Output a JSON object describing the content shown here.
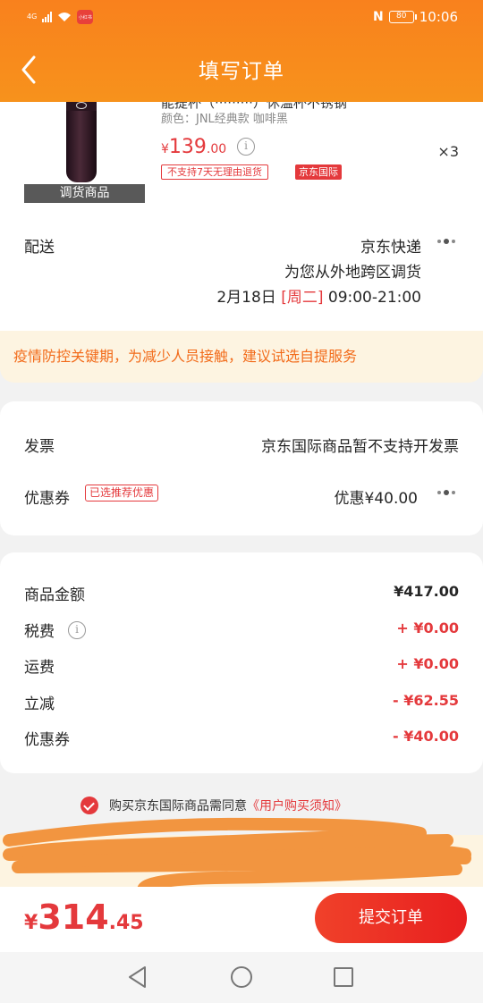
{
  "status_bar": {
    "network": "4G",
    "app_badge": "小红书",
    "nfc": "N",
    "battery": "80",
    "time": "10:06"
  },
  "header": {
    "title": "填写订单",
    "back_icon": "chevron-left-icon"
  },
  "product": {
    "name_partial": "能提杯（·········）休温杯不锈钢",
    "color_spec": "颜色：JNL经典款 咖啡黑",
    "price_currency": "¥",
    "price_int": "139",
    "price_dec": ".00",
    "quantity": "×3",
    "image_tag": "调货商品",
    "badge_no_return": "不支持7天无理由退货",
    "badge_intl": "京东国际"
  },
  "delivery": {
    "label": "配送",
    "carrier": "京东快递",
    "note": "为您从外地跨区调货",
    "date": "2月18日",
    "weekday": "[周二]",
    "time_window": "09:00-21:00"
  },
  "notice": "疫情防控关键期，为减少人员接触，建议试选自提服务",
  "invoice": {
    "label": "发票",
    "value": "京东国际商品暂不支持开发票"
  },
  "coupon": {
    "label": "优惠券",
    "tag": "已选推荐优惠",
    "value": "优惠¥40.00"
  },
  "summary": {
    "goods_label": "商品金额",
    "goods_value": "¥417.00",
    "tax_label": "税费",
    "tax_value": "+ ¥0.00",
    "shipping_label": "运费",
    "shipping_value": "+ ¥0.00",
    "discount_label": "立减",
    "discount_value": "- ¥62.55",
    "coupon_label": "优惠券",
    "coupon_value": "- ¥40.00"
  },
  "agreement": {
    "text": "购买京东国际商品需同意",
    "link": "《用户购买须知》"
  },
  "bottom": {
    "currency": "¥",
    "total_int": "314",
    "total_dec": ".45",
    "submit": "提交订单"
  },
  "colors": {
    "header_orange": "#f7921c",
    "jd_red": "#e4393c",
    "notice_orange": "#f26b1a",
    "notice_bg": "#fdf4e1",
    "scribble": "#f29540"
  }
}
